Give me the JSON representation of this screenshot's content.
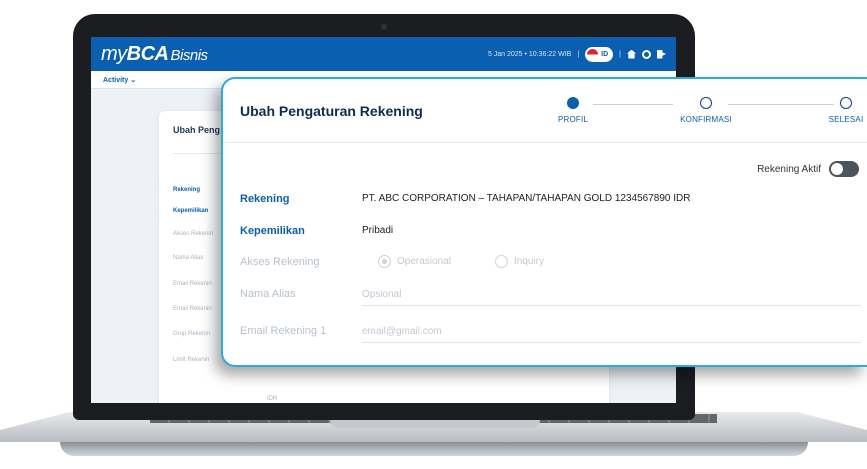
{
  "app": {
    "logo_my": "my",
    "logo_bca": "BCA",
    "logo_bisnis": "Bisnis",
    "datetime": "5 Jan 2025 • 10:36:22 WIB",
    "lang": "ID",
    "menu": "Activity ⌄"
  },
  "background_form": {
    "title": "Ubah Peng",
    "labels": [
      "Rekening",
      "Kepemilikan",
      "Akses Rekenin",
      "Nama Alias",
      "Email Rekenin",
      "Email Rekenin",
      "Grup Rekenin",
      "Limit Rekenin"
    ],
    "currency": "IDR"
  },
  "form": {
    "title": "Ubah Pengaturan Rekening",
    "steps": [
      {
        "label": "PROFIL",
        "done": true
      },
      {
        "label": "KONFIRMASI",
        "done": false
      },
      {
        "label": "SELESAI",
        "done": false
      }
    ],
    "toggle_label": "Rekening Aktif",
    "rekening": {
      "label": "Rekening",
      "value": "PT. ABC CORPORATION – TAHAPAN/TAHAPAN GOLD 1234567890 IDR"
    },
    "kepemilikan": {
      "label": "Kepemilikan",
      "value": "Pribadi"
    },
    "akses": {
      "label": "Akses Rekening",
      "option1": "Operasional",
      "option2": "Inquiry"
    },
    "alias": {
      "label": "Nama Alias",
      "placeholder": "Opsional"
    },
    "email1": {
      "label": "Email Rekening 1",
      "placeholder": "email@gmail.com"
    }
  }
}
